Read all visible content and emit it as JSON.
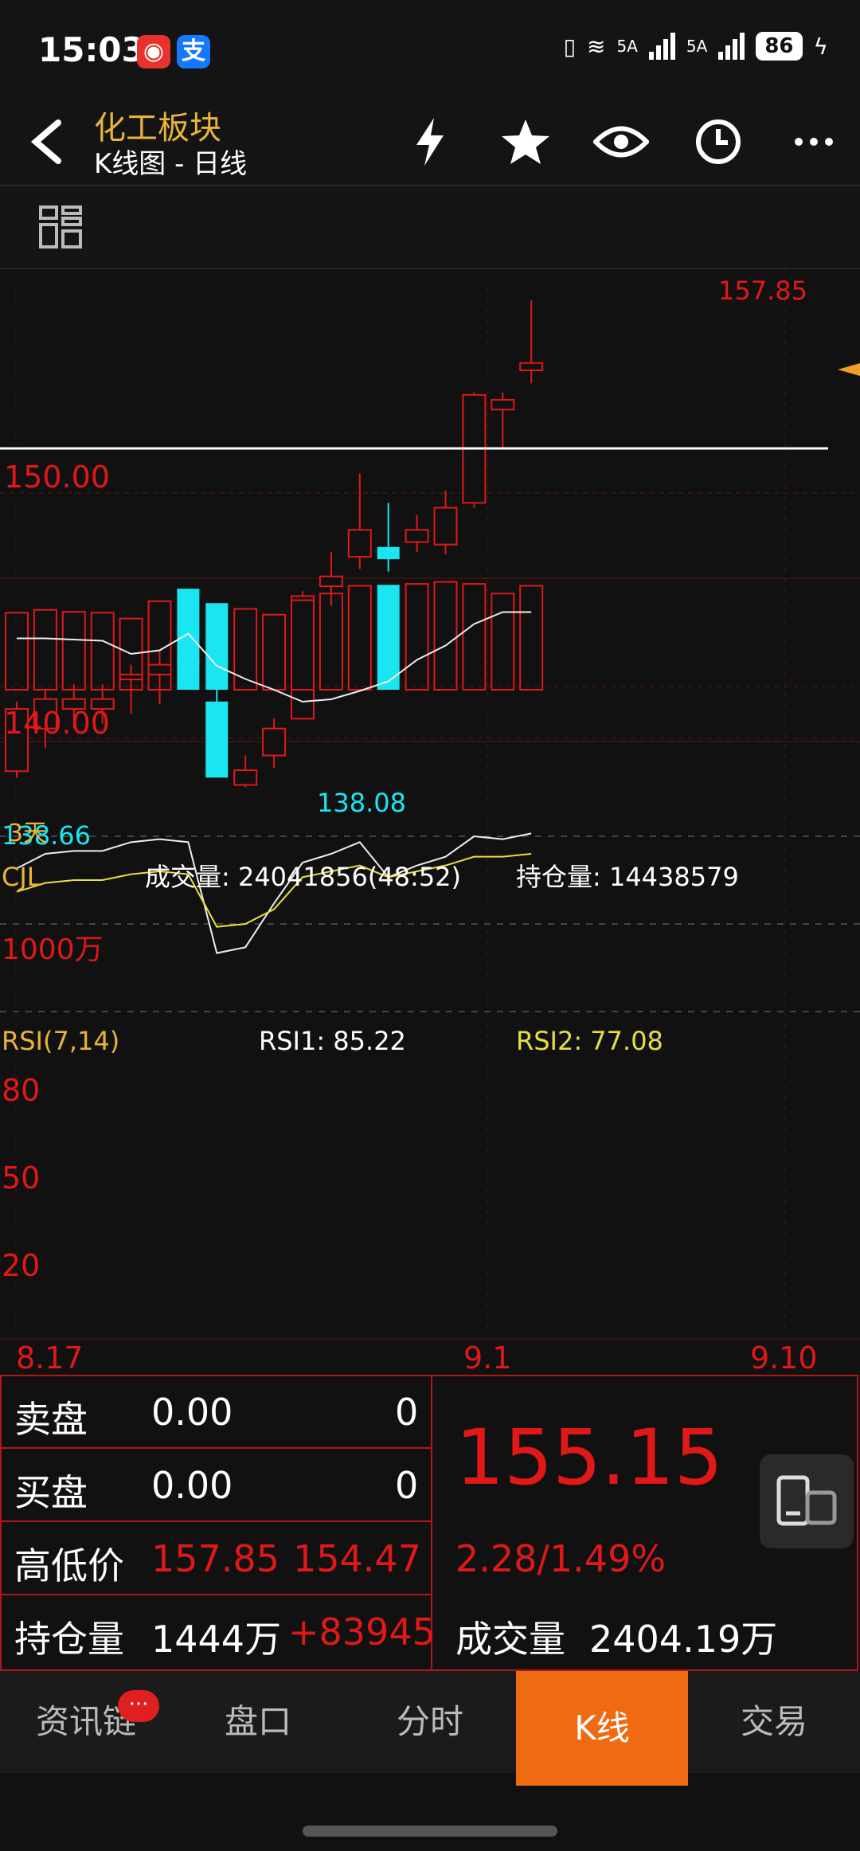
{
  "status": {
    "time": "15:03",
    "signal1_label": "5A",
    "signal2_label": "5A",
    "battery": "86"
  },
  "header": {
    "title": "化工板块",
    "subtitle": "K线图 - 日线"
  },
  "chart": {
    "price_high_label": "157.85",
    "price_low_label": "138.08",
    "left_low_label": "138.66",
    "three_day_label": "3天",
    "y_label_150": "150.00",
    "y_label_140": "140.00",
    "vol_title": "CJL",
    "vol_text": "成交量: 24041856(48:52)",
    "oi_text": "持仓量: 14438579",
    "vol_axis_label": "1000万",
    "rsi_title": "RSI(7,14)",
    "rsi1_text": "RSI1: 85.22",
    "rsi2_text": "RSI2: 77.08",
    "rsi_80": "80",
    "rsi_50": "50",
    "rsi_20": "20",
    "date_left": "8.17",
    "date_mid": "9.1",
    "date_right": "9.10"
  },
  "info": {
    "sell_label": "卖盘",
    "sell_price": "0.00",
    "sell_qty": "0",
    "buy_label": "买盘",
    "buy_price": "0.00",
    "buy_qty": "0",
    "hl_label": "高低价",
    "high": "157.85",
    "low": "154.47",
    "oi_label": "持仓量",
    "oi_value": "1444万",
    "oi_change": "+83945",
    "last_price": "155.15",
    "change": "2.28/1.49%",
    "vol_label": "成交量",
    "vol_value": "2404.19万"
  },
  "nav": {
    "items": [
      "资讯链",
      "盘口",
      "分时",
      "K线",
      "交易"
    ],
    "badge": "···"
  },
  "colors": {
    "up": "#e01818",
    "down": "#19e6f0",
    "title": "#e8b43a",
    "active_tab": "#f06a12"
  },
  "candles": [
    {
      "o": 138.66,
      "c": 141.2,
      "h": 141.5,
      "l": 138.4,
      "v": 8.0
    },
    {
      "o": 140.4,
      "c": 141.6,
      "h": 142.0,
      "l": 139.6,
      "v": 8.3
    },
    {
      "o": 141.2,
      "c": 141.6,
      "h": 142.2,
      "l": 140.4,
      "v": 8.1
    },
    {
      "o": 141.2,
      "c": 141.6,
      "h": 142.2,
      "l": 140.6,
      "v": 8.0
    },
    {
      "o": 142.4,
      "c": 142.6,
      "h": 143.0,
      "l": 141.0,
      "v": 7.4
    },
    {
      "o": 142.6,
      "c": 143.0,
      "h": 143.6,
      "l": 141.4,
      "v": 9.2
    },
    {
      "o": 143.2,
      "c": 143.0,
      "h": 146.0,
      "l": 143.0,
      "v": 10.5
    },
    {
      "o": 141.5,
      "c": 138.4,
      "h": 142.0,
      "l": 138.4,
      "v": 9.0
    },
    {
      "o": 138.1,
      "c": 138.7,
      "h": 139.3,
      "l": 138.0,
      "v": 8.4
    },
    {
      "o": 139.3,
      "c": 140.4,
      "h": 140.8,
      "l": 138.8,
      "v": 7.8
    },
    {
      "o": 140.8,
      "c": 145.8,
      "h": 146.0,
      "l": 140.8,
      "v": 9.3
    },
    {
      "o": 146.2,
      "c": 146.6,
      "h": 147.6,
      "l": 145.4,
      "v": 10.0
    },
    {
      "o": 147.4,
      "c": 148.5,
      "h": 150.8,
      "l": 146.9,
      "v": 10.8
    },
    {
      "o": 147.8,
      "c": 147.3,
      "h": 149.6,
      "l": 146.8,
      "v": 10.9
    },
    {
      "o": 148.0,
      "c": 148.5,
      "h": 149.1,
      "l": 147.6,
      "v": 11.0
    },
    {
      "o": 147.9,
      "c": 149.4,
      "h": 150.1,
      "l": 147.5,
      "v": 11.2
    },
    {
      "o": 149.6,
      "c": 154.0,
      "h": 154.1,
      "l": 149.4,
      "v": 11.0
    },
    {
      "o": 153.4,
      "c": 153.8,
      "h": 154.1,
      "l": 151.8,
      "v": 10.0
    },
    {
      "o": 155.0,
      "c": 155.3,
      "h": 157.85,
      "l": 154.47,
      "v": 10.8
    }
  ],
  "oi_line": [
    1.08,
    1.08,
    1.07,
    1.06,
    0.95,
    0.98,
    1.12,
    0.85,
    0.74,
    0.65,
    0.55,
    0.57,
    0.64,
    0.72,
    0.9,
    1.02,
    1.2,
    1.3,
    1.3
  ],
  "rsi1": [
    69,
    74,
    75,
    75,
    78,
    79,
    78,
    40,
    42,
    57,
    71,
    74,
    78,
    66,
    70,
    73,
    80,
    79,
    81
  ],
  "rsi2": [
    61,
    64,
    65,
    65,
    67,
    68,
    67,
    49,
    50,
    55,
    66,
    68,
    70,
    66,
    68,
    70,
    73,
    73,
    74
  ]
}
